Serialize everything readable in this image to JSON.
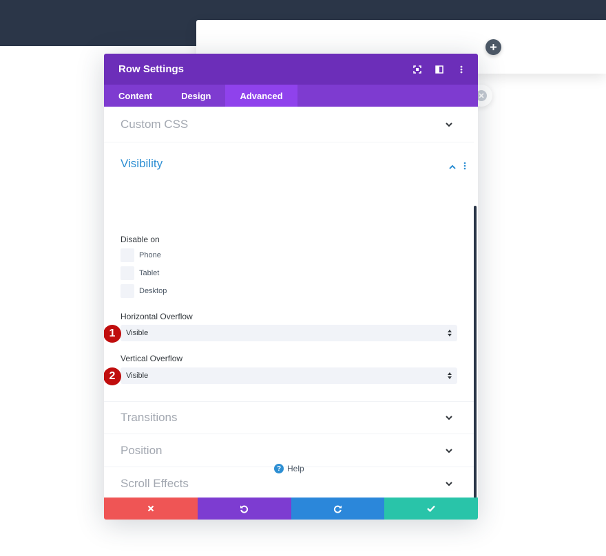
{
  "modal": {
    "title": "Row Settings",
    "tabs": [
      {
        "label": "Content",
        "active": false
      },
      {
        "label": "Design",
        "active": false
      },
      {
        "label": "Advanced",
        "active": true
      }
    ]
  },
  "sections": {
    "custom_css": "Custom CSS",
    "visibility": {
      "title": "Visibility",
      "disable_on_label": "Disable on",
      "options": [
        {
          "label": "Phone",
          "checked": false
        },
        {
          "label": "Tablet",
          "checked": false
        },
        {
          "label": "Desktop",
          "checked": false
        }
      ],
      "horizontal_overflow": {
        "label": "Horizontal Overflow",
        "value": "Visible",
        "marker": "1"
      },
      "vertical_overflow": {
        "label": "Vertical Overflow",
        "value": "Visible",
        "marker": "2"
      }
    },
    "transitions": "Transitions",
    "position": "Position",
    "scroll_effects": "Scroll Effects"
  },
  "help": {
    "label": "Help"
  },
  "colors": {
    "header": "#6c2eb9",
    "tabs": "#7e3bd0",
    "active_tab": "#8f42ec",
    "cancel": "#ef5555",
    "undo": "#7d3cd1",
    "redo": "#2b87da",
    "save": "#29c4a9",
    "accent": "#2e8fd3",
    "marker": "#c00d0d"
  }
}
